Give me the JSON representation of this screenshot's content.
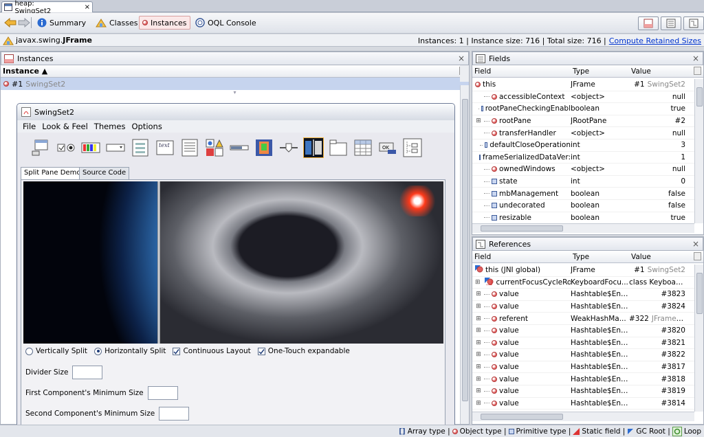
{
  "doc_tab": {
    "title": "heap: SwingSet2",
    "close": "×"
  },
  "toolbar": {
    "summary": "Summary",
    "classes": "Classes",
    "instances": "Instances",
    "oql": "OQL Console"
  },
  "infobar": {
    "class_name_prefix": "javax.swing.",
    "class_name": "JFrame",
    "instances_text": "Instances: 1 | Instance size: 716 | Total size: 716 |",
    "compute_link": "Compute Retained Sizes"
  },
  "instances_panel": {
    "title": "Instances",
    "close": "×",
    "column": "Instance ▲",
    "row_id": "#1",
    "row_name": "SwingSet2"
  },
  "swingset": {
    "title": "SwingSet2",
    "menus": [
      "File",
      "Look & Feel",
      "Themes",
      "Options"
    ],
    "tabs": [
      "Split Pane Demo",
      "Source Code"
    ],
    "options": {
      "vertical": "Vertically Split",
      "horizontal": "Horizontally Split",
      "continuous": "Continuous Layout",
      "onetouch": "One-Touch expandable"
    },
    "divider_label": "Divider Size",
    "first_min_label": "First Component's Minimum Size",
    "second_min_label": "Second Component's Minimum Size",
    "button_text": "text",
    "ok_text": "OK"
  },
  "fields_panel": {
    "title": "Fields",
    "close": "×",
    "headers": [
      "Field",
      "Type",
      "Value"
    ],
    "rows": [
      {
        "field": "this",
        "type": "JFrame",
        "value": "#1",
        "value_grey": "SwingSet2",
        "icon": "object",
        "indent": 0
      },
      {
        "field": "accessibleContext",
        "type": "<object>",
        "value": "null",
        "icon": "object",
        "indent": 1
      },
      {
        "field": "rootPaneCheckingEnabl",
        "type": "boolean",
        "value": "true",
        "icon": "primitive",
        "indent": 1
      },
      {
        "field": "rootPane",
        "type": "JRootPane",
        "value": "#2",
        "icon": "object",
        "indent": 1,
        "expand": "+"
      },
      {
        "field": "transferHandler",
        "type": "<object>",
        "value": "null",
        "icon": "object",
        "indent": 1
      },
      {
        "field": "defaultCloseOperation",
        "type": "int",
        "value": "3",
        "icon": "primitive",
        "indent": 1
      },
      {
        "field": "frameSerializedDataVer:",
        "type": "int",
        "value": "1",
        "icon": "primitive",
        "indent": 1
      },
      {
        "field": "ownedWindows",
        "type": "<object>",
        "value": "null",
        "icon": "object",
        "indent": 1
      },
      {
        "field": "state",
        "type": "int",
        "value": "0",
        "icon": "primitive",
        "indent": 1
      },
      {
        "field": "mbManagement",
        "type": "boolean",
        "value": "false",
        "icon": "primitive",
        "indent": 1
      },
      {
        "field": "undecorated",
        "type": "boolean",
        "value": "false",
        "icon": "primitive",
        "indent": 1
      },
      {
        "field": "resizable",
        "type": "boolean",
        "value": "true",
        "icon": "primitive",
        "indent": 1
      }
    ]
  },
  "references_panel": {
    "title": "References",
    "close": "×",
    "headers": [
      "Field",
      "Type",
      "Value"
    ],
    "rows": [
      {
        "field": "this (JNI global)",
        "type": "JFrame",
        "value": "#1",
        "value_grey": "SwingSet2",
        "icon": "gcroot",
        "indent": 0
      },
      {
        "field": "currentFocusCycleRoot",
        "type": "KeyboardFocu...",
        "value": "class Keyboard...",
        "icon": "static",
        "indent": 1,
        "expand": "+"
      },
      {
        "field": "value",
        "type": "Hashtable$Entry",
        "value": "#3823",
        "icon": "object",
        "indent": 1,
        "expand": "+"
      },
      {
        "field": "value",
        "type": "Hashtable$Entry",
        "value": "#3824",
        "icon": "object",
        "indent": 1,
        "expand": "+"
      },
      {
        "field": "referent",
        "type": "WeakHashMa...",
        "value": "#322",
        "value_grey": "JFrame: ...",
        "icon": "object",
        "indent": 1,
        "expand": "+"
      },
      {
        "field": "value",
        "type": "Hashtable$Entry",
        "value": "#3820",
        "icon": "object",
        "indent": 1,
        "expand": "+"
      },
      {
        "field": "value",
        "type": "Hashtable$Entry",
        "value": "#3821",
        "icon": "object",
        "indent": 1,
        "expand": "+"
      },
      {
        "field": "value",
        "type": "Hashtable$Entry",
        "value": "#3822",
        "icon": "object",
        "indent": 1,
        "expand": "+"
      },
      {
        "field": "value",
        "type": "Hashtable$Entry",
        "value": "#3817",
        "icon": "object",
        "indent": 1,
        "expand": "+"
      },
      {
        "field": "value",
        "type": "Hashtable$Entry",
        "value": "#3818",
        "icon": "object",
        "indent": 1,
        "expand": "+"
      },
      {
        "field": "value",
        "type": "Hashtable$Entry",
        "value": "#3819",
        "icon": "object",
        "indent": 1,
        "expand": "+"
      },
      {
        "field": "value",
        "type": "Hashtable$Entry",
        "value": "#3814",
        "icon": "object",
        "indent": 1,
        "expand": "+"
      }
    ]
  },
  "statusbar": {
    "array": "Array type |",
    "object": "Object type |",
    "primitive": "Primitive type |",
    "static": "Static field |",
    "gcroot": "GC Root |",
    "loop": "Loop"
  },
  "colors": {
    "selection": "#c6d4ee",
    "link": "#0033cc",
    "object_icon": "#e06060"
  }
}
